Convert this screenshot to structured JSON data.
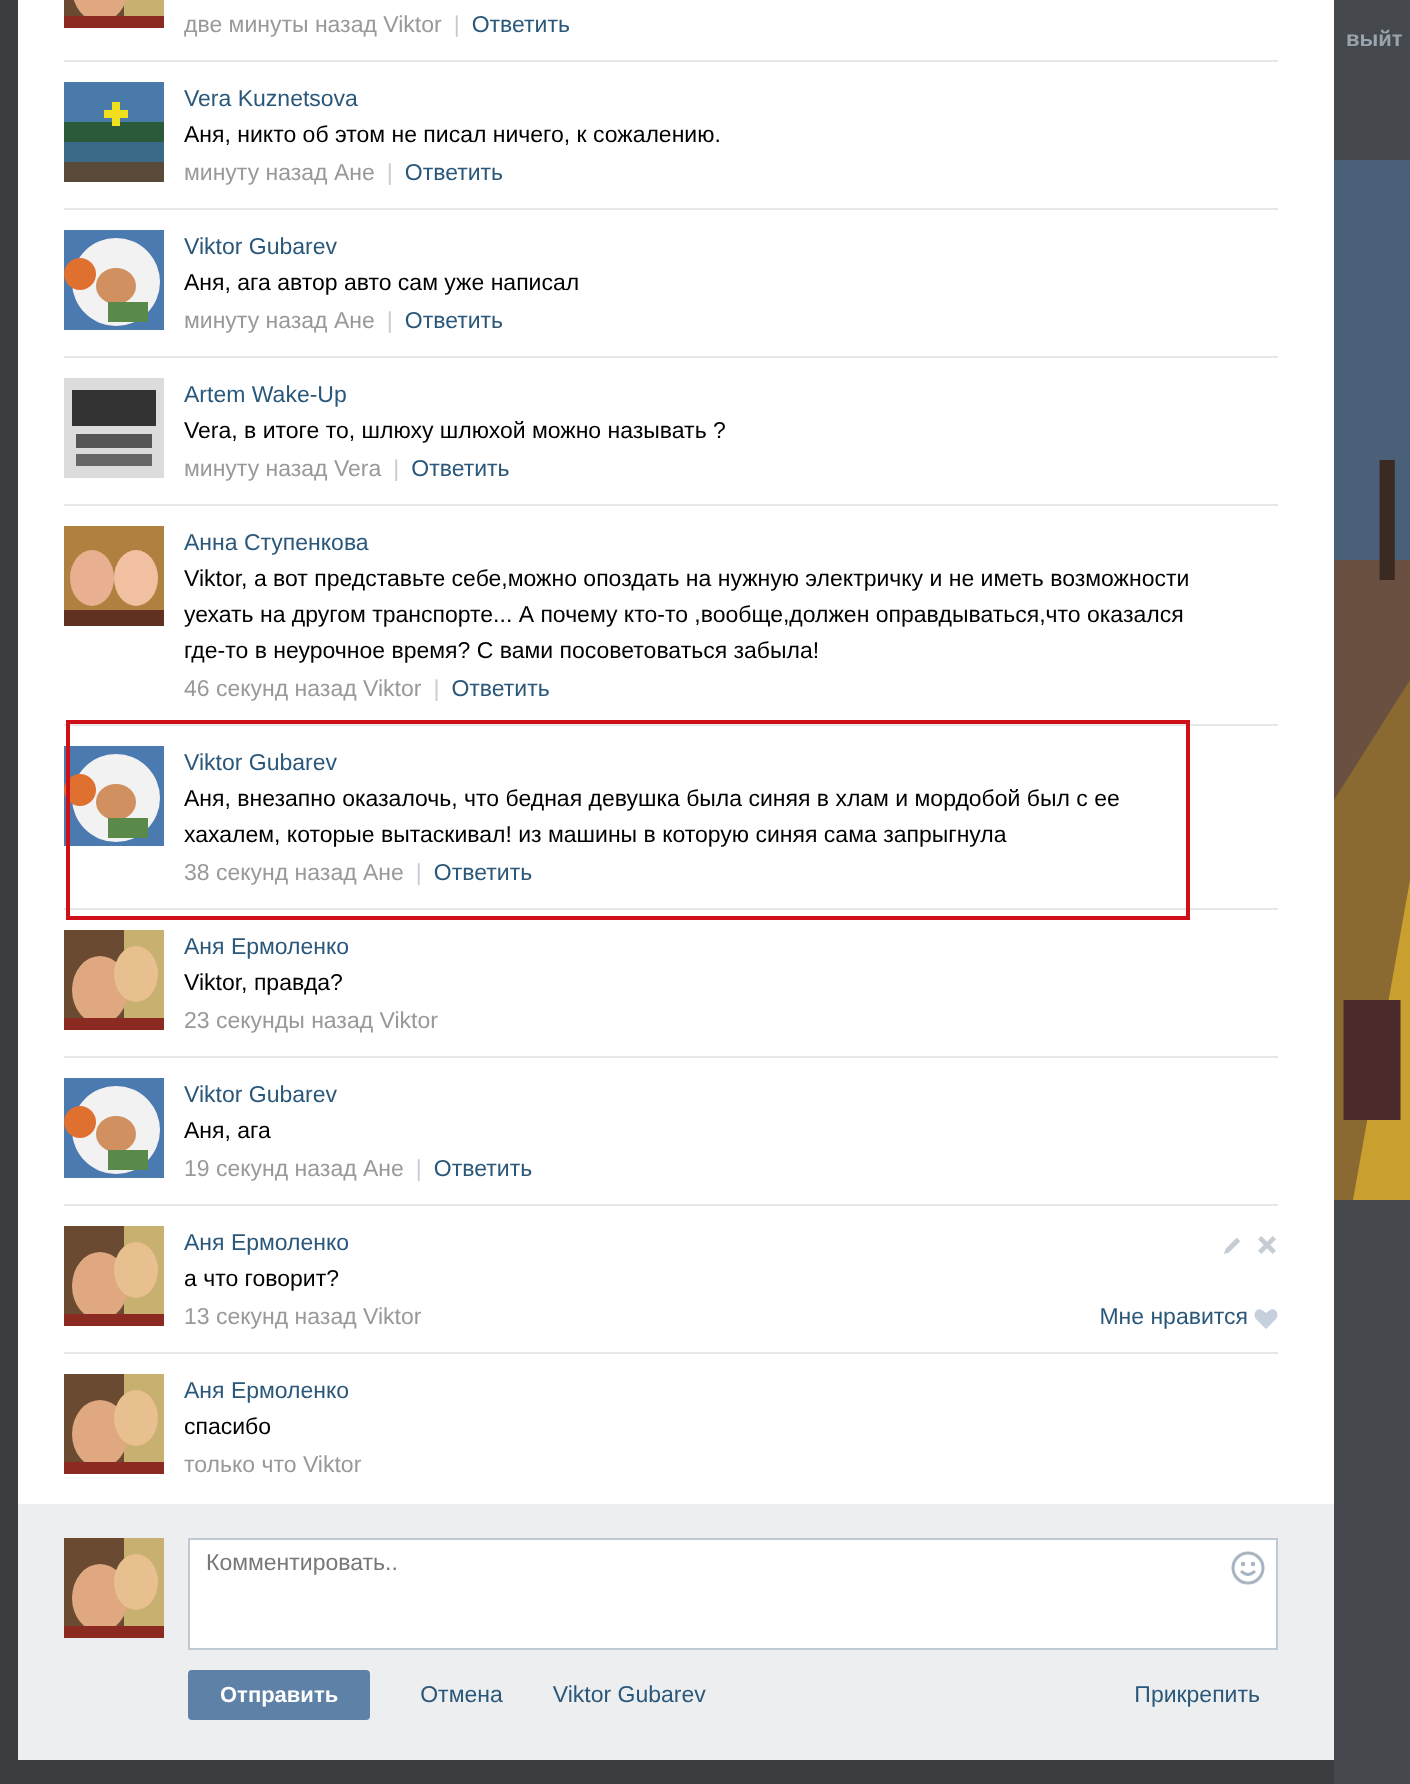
{
  "page": {
    "logout_link": "выйт"
  },
  "comments": [
    {
      "kind": "partial",
      "time": "две минуты назад Viktor",
      "separator": "|",
      "reply": "Ответить",
      "highlighted": false
    },
    {
      "kind": "full",
      "author": "Vera Kuznetsova",
      "text": "Аня, никто об этом не писал ничего, к сожалению.",
      "time": "минуту назад Ане",
      "separator": "|",
      "reply": "Ответить",
      "highlighted": false
    },
    {
      "kind": "full",
      "author": "Viktor Gubarev",
      "text": "Аня, ага автор авто сам уже написал",
      "time": "минуту назад Ане",
      "separator": "|",
      "reply": "Ответить",
      "highlighted": false
    },
    {
      "kind": "full",
      "author": "Artem Wake-Up",
      "text": "Vera, в итоге то, шлюху шлюхой можно называть ?",
      "time": "минуту назад Vera",
      "separator": "|",
      "reply": "Ответить",
      "highlighted": false
    },
    {
      "kind": "full",
      "author": "Анна Ступенкова",
      "text": "Viktor, а вот представьте себе,можно опоздать на нужную электричку и не иметь возможности уехать на другом транспорте... А почему кто-то ,вообще,должен оправдываться,что оказался где-то в неурочное время? С вами посоветоваться забыла!",
      "time": "46 секунд назад Viktor",
      "separator": "|",
      "reply": "Ответить",
      "highlighted": false
    },
    {
      "kind": "full",
      "author": "Viktor Gubarev",
      "text": "Аня, внезапно оказалочь, что бедная девушка была синяя в хлам и мордобой был с ее хахалем, которые вытаскивал! из машины в которую синяя сама запрыгнула",
      "time": "38 секунд назад Ане",
      "separator": "|",
      "reply": "Ответить",
      "highlighted": true
    },
    {
      "kind": "full",
      "author": "Аня Ермоленко",
      "text": "Viktor, правда?",
      "time": "23 секунды назад Viktor",
      "highlighted": false
    },
    {
      "kind": "full",
      "author": "Viktor Gubarev",
      "text": "Аня, ага",
      "time": "19 секунд назад Ане",
      "separator": "|",
      "reply": "Ответить",
      "highlighted": false
    },
    {
      "kind": "own",
      "author": "Аня Ермоленко",
      "text": "а что говорит?",
      "time": "13 секунд назад Viktor",
      "like": "Мне нравится",
      "highlighted": false
    },
    {
      "kind": "full",
      "author": "Аня Ермоленко",
      "text": "спасибо",
      "time": "только что Viktor",
      "highlighted": false
    }
  ],
  "form": {
    "placeholder": "Комментировать..",
    "send": "Отправить",
    "cancel": "Отмена",
    "as_name": "Viktor Gubarev",
    "attach": "Прикрепить"
  }
}
